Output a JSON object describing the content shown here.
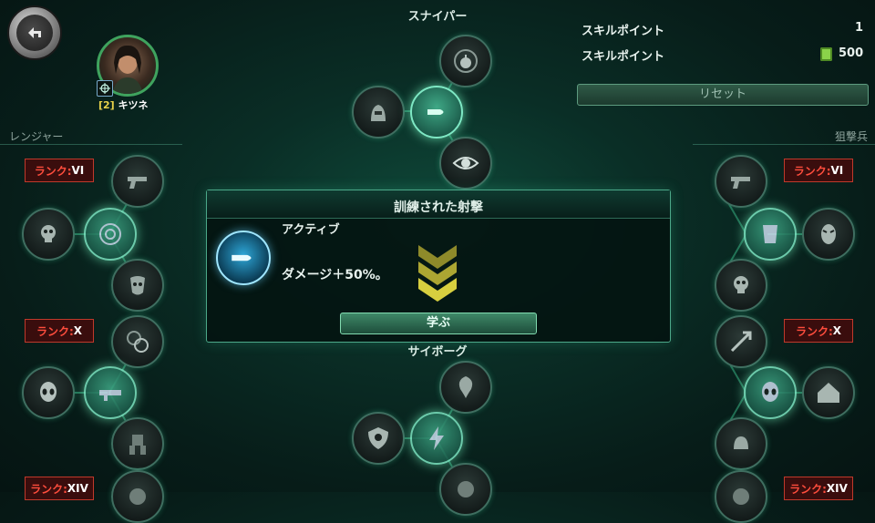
{
  "top_bar": {
    "back_icon": "back-arrow-icon",
    "tree_titles": {
      "sniper": "スナイパー",
      "ranger": "レンジャー",
      "marksman": "狙撃兵",
      "cyborg": "サイボーグ"
    }
  },
  "character": {
    "level": "[2]",
    "name": "キツネ",
    "class_icon": "crosshair-icon"
  },
  "skill_points": {
    "label": "スキルポイント",
    "value": "1",
    "cost_label": "スキルポイント",
    "cost_value": "500",
    "currency_icon": "cash-icon",
    "reset_label": "リセット"
  },
  "ranks": [
    {
      "prefix": "ランク:",
      "value": "VI"
    },
    {
      "prefix": "ランク:",
      "value": "X"
    },
    {
      "prefix": "ランク:",
      "value": "XIV"
    },
    {
      "prefix": "ランク:",
      "value": "VI"
    },
    {
      "prefix": "ランク:",
      "value": "X"
    },
    {
      "prefix": "ランク:",
      "value": "XIV"
    }
  ],
  "skill_popup": {
    "title": "訓練された射撃",
    "type": "アクティブ",
    "description": "ダメージ＋50%。",
    "learn_label": "学ぶ",
    "skill_icon": "bullet-icon",
    "rank_icon": "chevron-rank-icon"
  },
  "colors": {
    "accent": "#5fd3a8",
    "rank_red": "#ff4d3d",
    "cash_green": "#8bd34a",
    "chevron_gold": "#c9c23a"
  }
}
